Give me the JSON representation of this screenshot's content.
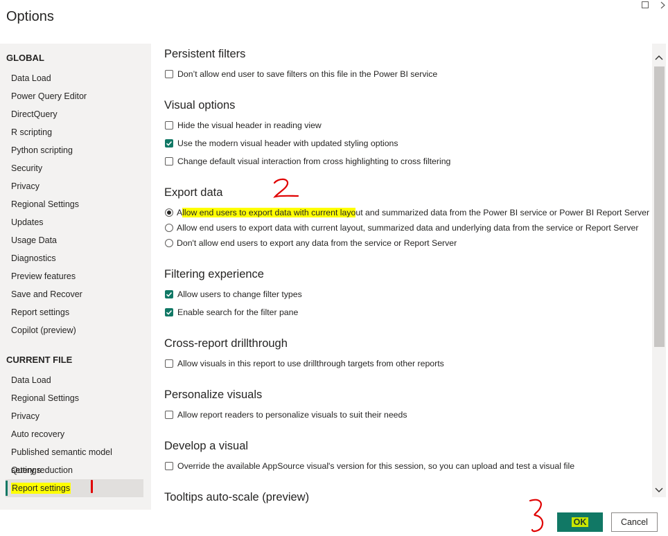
{
  "window": {
    "title": "Options"
  },
  "sidebar": {
    "global_header": "GLOBAL",
    "global_items": [
      {
        "label": "Data Load"
      },
      {
        "label": "Power Query Editor"
      },
      {
        "label": "DirectQuery"
      },
      {
        "label": "R scripting"
      },
      {
        "label": "Python scripting"
      },
      {
        "label": "Security"
      },
      {
        "label": "Privacy"
      },
      {
        "label": "Regional Settings"
      },
      {
        "label": "Updates"
      },
      {
        "label": "Usage Data"
      },
      {
        "label": "Diagnostics"
      },
      {
        "label": "Preview features"
      },
      {
        "label": "Save and Recover"
      },
      {
        "label": "Report settings"
      },
      {
        "label": "Copilot (preview)"
      }
    ],
    "current_header": "CURRENT FILE",
    "current_items": [
      {
        "label": "Data Load"
      },
      {
        "label": "Regional Settings"
      },
      {
        "label": "Privacy"
      },
      {
        "label": "Auto recovery"
      },
      {
        "label": "Published semantic model settings"
      },
      {
        "label": "Query reduction"
      },
      {
        "label": "Report settings",
        "selected": true
      }
    ]
  },
  "content": {
    "persistent_filters": {
      "heading": "Persistent filters",
      "options": [
        {
          "label": "Don’t allow end user to save filters on this file in the Power BI service",
          "checked": false
        }
      ]
    },
    "visual_options": {
      "heading": "Visual options",
      "options": [
        {
          "label": "Hide the visual header in reading view",
          "checked": false
        },
        {
          "label": "Use the modern visual header with updated styling options",
          "checked": true
        },
        {
          "label": "Change default visual interaction from cross highlighting to cross filtering",
          "checked": false
        }
      ]
    },
    "export_data": {
      "heading": "Export data",
      "options": [
        {
          "label_a": "A",
          "label_hl": "llow end users to export data with current layo",
          "label_b": "ut and summarized data from the Power BI service or Power BI Report Server",
          "selected": true
        },
        {
          "label": "Allow end users to export data with current layout, summarized data and underlying data from the service or Report Server",
          "selected": false
        },
        {
          "label": "Don't allow end users to export any data from the service or Report Server",
          "selected": false
        }
      ]
    },
    "filtering_experience": {
      "heading": "Filtering experience",
      "options": [
        {
          "label": "Allow users to change filter types",
          "checked": true
        },
        {
          "label": "Enable search for the filter pane",
          "checked": true
        }
      ]
    },
    "cross_report": {
      "heading": "Cross-report drillthrough",
      "options": [
        {
          "label": "Allow visuals in this report to use drillthrough targets from other reports",
          "checked": false
        }
      ]
    },
    "personalize_visuals": {
      "heading": "Personalize visuals",
      "options": [
        {
          "label": "Allow report readers to personalize visuals to suit their needs",
          "checked": false
        }
      ]
    },
    "develop_visual": {
      "heading": "Develop a visual",
      "options": [
        {
          "label": "Override the available AppSource visual's version for this session, so you can upload and test a visual file",
          "checked": false
        }
      ]
    },
    "tooltips": {
      "heading": "Tooltips auto-scale (preview)"
    }
  },
  "footer": {
    "ok_label": "OK",
    "cancel_label": "Cancel"
  },
  "colors": {
    "accent": "#117865",
    "highlight": "#ffff00",
    "annotation": "#e00000"
  }
}
